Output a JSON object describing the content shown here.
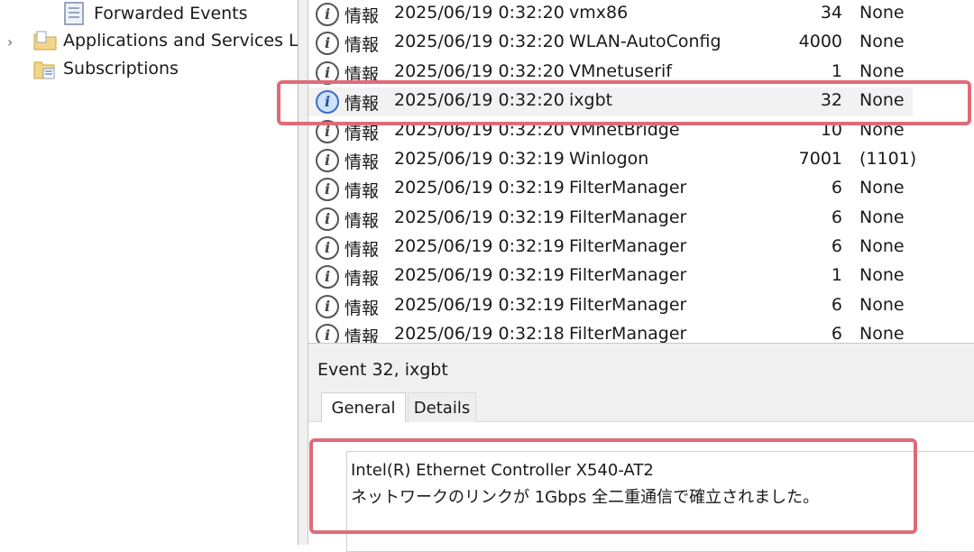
{
  "tree": {
    "items": [
      {
        "label": "Forwarded Events",
        "icon": "log-file-icon"
      },
      {
        "label": "Applications and Services Log",
        "icon": "folder-icon",
        "expander": "›"
      },
      {
        "label": "Subscriptions",
        "icon": "subscriptions-icon"
      }
    ]
  },
  "event_list": {
    "rows": [
      {
        "level": "情報",
        "date": "2025/06/19 0:32:20",
        "source": "vmx86",
        "id": "34",
        "task": "None"
      },
      {
        "level": "情報",
        "date": "2025/06/19 0:32:20",
        "source": "WLAN-AutoConfig",
        "id": "4000",
        "task": "None"
      },
      {
        "level": "情報",
        "date": "2025/06/19 0:32:20",
        "source": "VMnetuserif",
        "id": "1",
        "task": "None"
      },
      {
        "level": "情報",
        "date": "2025/06/19 0:32:20",
        "source": "ixgbt",
        "id": "32",
        "task": "None"
      },
      {
        "level": "情報",
        "date": "2025/06/19 0:32:20",
        "source": "VMnetBridge",
        "id": "10",
        "task": "None"
      },
      {
        "level": "情報",
        "date": "2025/06/19 0:32:19",
        "source": "Winlogon",
        "id": "7001",
        "task": "(1101)"
      },
      {
        "level": "情報",
        "date": "2025/06/19 0:32:19",
        "source": "FilterManager",
        "id": "6",
        "task": "None"
      },
      {
        "level": "情報",
        "date": "2025/06/19 0:32:19",
        "source": "FilterManager",
        "id": "6",
        "task": "None"
      },
      {
        "level": "情報",
        "date": "2025/06/19 0:32:19",
        "source": "FilterManager",
        "id": "6",
        "task": "None"
      },
      {
        "level": "情報",
        "date": "2025/06/19 0:32:19",
        "source": "FilterManager",
        "id": "1",
        "task": "None"
      },
      {
        "level": "情報",
        "date": "2025/06/19 0:32:19",
        "source": "FilterManager",
        "id": "6",
        "task": "None"
      },
      {
        "level": "情報",
        "date": "2025/06/19 0:32:18",
        "source": "FilterManager",
        "id": "6",
        "task": "None"
      }
    ]
  },
  "details": {
    "title": "Event 32, ixgbt",
    "tabs": [
      "General",
      "Details"
    ],
    "message_line1": "Intel(R) Ethernet Controller X540-AT2",
    "message_line2": " ネットワークのリンクが 1Gbps 全二重通信で確立されました。"
  },
  "colors": {
    "highlight": "#e06b78",
    "info_icon_selected": "#cfe2fb"
  }
}
